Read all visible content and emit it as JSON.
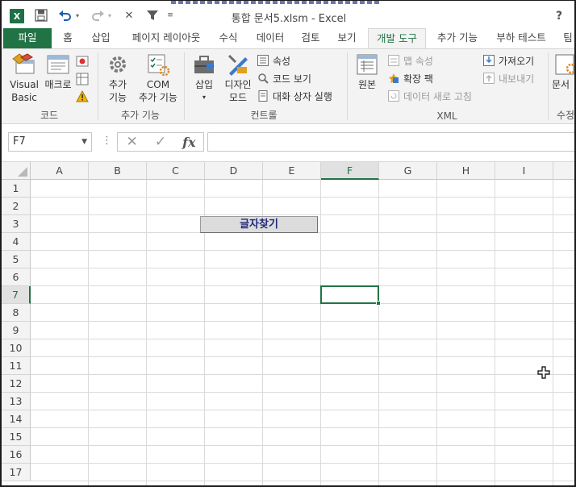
{
  "window": {
    "title": "통합 문서5.xlsm - Excel",
    "help_label": "?",
    "app_icon_label": "X"
  },
  "tabs": [
    {
      "label": "파일",
      "active": false,
      "file": true
    },
    {
      "label": "홈"
    },
    {
      "label": "삽입"
    },
    {
      "label": "페이지 레이아웃"
    },
    {
      "label": "수식"
    },
    {
      "label": "데이터"
    },
    {
      "label": "검토"
    },
    {
      "label": "보기"
    },
    {
      "label": "개발 도구",
      "active": true
    },
    {
      "label": "추가 기능"
    },
    {
      "label": "부하 테스트"
    },
    {
      "label": "팀"
    }
  ],
  "ribbon": {
    "code": {
      "group_label": "코드",
      "visual_basic_line1": "Visual",
      "visual_basic_line2": "Basic",
      "macro_label": "매크로"
    },
    "addins": {
      "group_label": "추가 기능",
      "addins_line1": "추가",
      "addins_line2": "기능",
      "com_line1": "COM",
      "com_line2": "추가 기능"
    },
    "controls": {
      "group_label": "컨트롤",
      "insert_label": "삽입",
      "design_line1": "디자인",
      "design_line2": "모드",
      "properties_label": "속성",
      "view_code_label": "코드 보기",
      "run_dialog_label": "대화 상자 실행"
    },
    "xml": {
      "group_label": "XML",
      "source_label": "원본",
      "map_properties_label": "맵 속성",
      "expansion_packs_label": "확장 팩",
      "refresh_data_label": "데이터 새로 고침",
      "import_label": "가져오기",
      "export_label": "내보내기"
    },
    "modify": {
      "group_label": "수정",
      "doc_panel_label": "문서"
    }
  },
  "formula_bar": {
    "name_box": "F7",
    "formula": "",
    "fx_label": "fx",
    "cancel_symbol": "✕",
    "enter_symbol": "✓"
  },
  "sheet": {
    "columns": [
      "A",
      "B",
      "C",
      "D",
      "E",
      "F",
      "G",
      "H",
      "I"
    ],
    "rows": [
      "1",
      "2",
      "3",
      "4",
      "5",
      "6",
      "7",
      "8",
      "9",
      "10",
      "11",
      "12",
      "13",
      "14",
      "15",
      "16",
      "17"
    ],
    "selected_cell": "F7",
    "form_button_label": "글자찾기"
  },
  "colors": {
    "accent": "#217346",
    "button_text": "#1f2a7a"
  }
}
